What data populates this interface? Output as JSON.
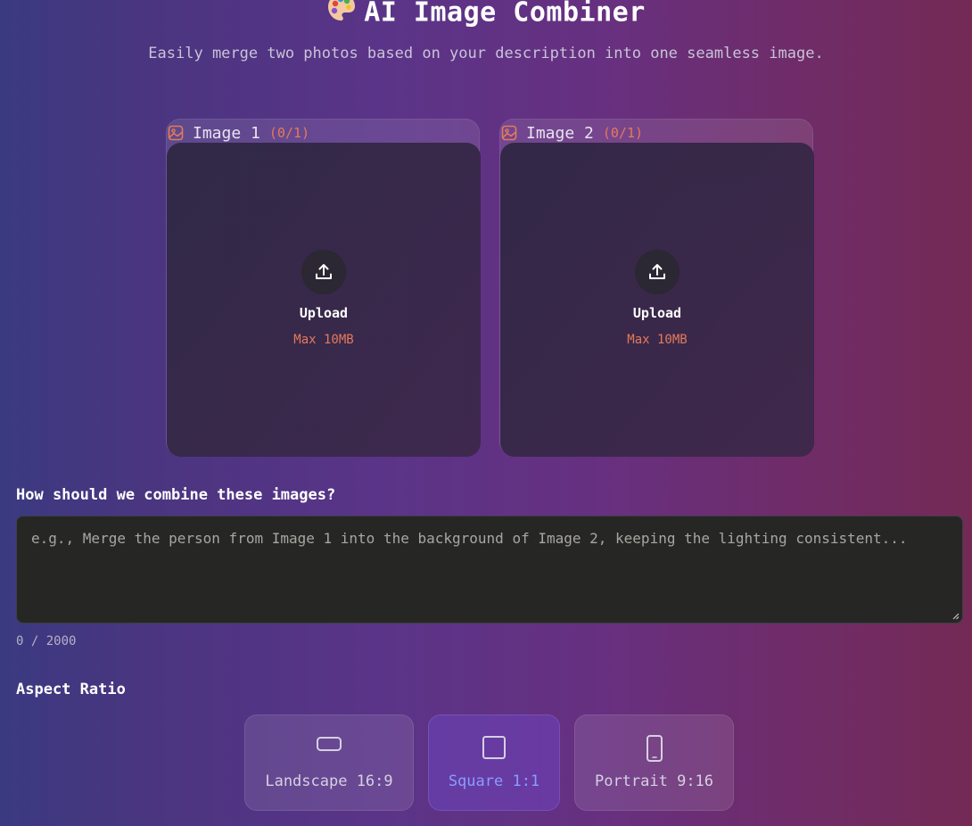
{
  "header": {
    "title": "AI Image Combiner",
    "subtitle": "Easily merge two photos based on your description into one seamless image."
  },
  "images": [
    {
      "label": "Image 1",
      "count": "(0/1)",
      "upload_label": "Upload",
      "max_label": "Max 10MB"
    },
    {
      "label": "Image 2",
      "count": "(0/1)",
      "upload_label": "Upload",
      "max_label": "Max 10MB"
    }
  ],
  "prompt": {
    "label": "How should we combine these images?",
    "placeholder": "e.g., Merge the person from Image 1 into the background of Image 2, keeping the lighting consistent...",
    "value": "",
    "char_count": "0 / 2000"
  },
  "aspect": {
    "label": "Aspect Ratio",
    "options": [
      {
        "label": "Landscape 16:9",
        "icon": "landscape-rect-icon",
        "selected": false
      },
      {
        "label": "Square 1:1",
        "icon": "square-icon",
        "selected": true
      },
      {
        "label": "Portrait 9:16",
        "icon": "portrait-phone-icon",
        "selected": false
      }
    ]
  },
  "colors": {
    "accent": "#e47a5a",
    "selected_text": "#8a9cff",
    "textarea_bg": "#262624"
  }
}
